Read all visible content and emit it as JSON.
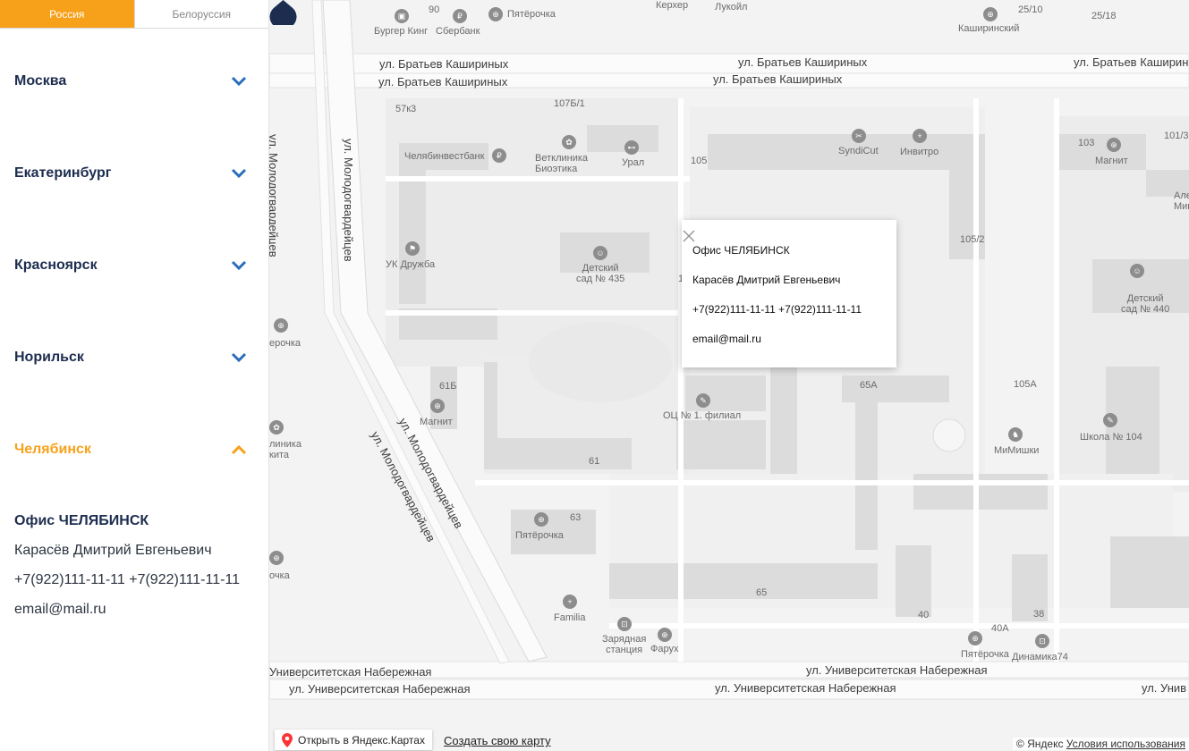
{
  "tabs": [
    {
      "label": "Россия",
      "active": true
    },
    {
      "label": "Белоруссия",
      "active": false
    }
  ],
  "cities": [
    {
      "name": "Москва",
      "open": false
    },
    {
      "name": "Екатеринбург",
      "open": false
    },
    {
      "name": "Красноярск",
      "open": false
    },
    {
      "name": "Норильск",
      "open": false
    },
    {
      "name": "Челябинск",
      "open": true
    }
  ],
  "office": {
    "title": "Офис ЧЕЛЯБИНСК",
    "person": "Карасёв Дмитрий Евгеньевич",
    "phones": "+7(922)111-11-11 +7(922)111-11-11",
    "email": "email@mail.ru"
  },
  "popup": {
    "title": "Офис ЧЕЛЯБИНСК",
    "person": "Карасёв Дмитрий Евгеньевич",
    "phones": "+7(922)111-11-11 +7(922)111-11-11",
    "email": "email@mail.ru"
  },
  "map": {
    "streets": {
      "bk1": "ул. Братьев Кашириных",
      "bk2": "ул. Братьев Кашириных",
      "bk3": "ул. Братьев Кашириных",
      "bk4": "ул. Братьев Кашириных",
      "bk5": "ул. Братьев Каширины",
      "mol1": "ул. Молодогвардейцев",
      "mol2": "ул. Молодогвардейцев",
      "mol3": "ул. Молодогвардейцев",
      "mol4": "ул. Молодогвардейцев",
      "un1": "Университетская Набережная",
      "un2": "ул. Университетская Набережная",
      "un3": "ул. Университетская Набережная",
      "un4": "ул. Университетская Набережная",
      "un5": "ул. Унив"
    },
    "places": {
      "burger": "Бургер Кинг",
      "sber": "Сбербанк",
      "pyat1": "Пятёрочка",
      "kerher": "Керхер",
      "lukoil": "Лукойл",
      "kash": "Каширинский",
      "chelinvest": "Челябинвестбанк",
      "vet": "Ветклиника\nБиоэтика",
      "ural": "Урал",
      "syndicut": "SyndiCut",
      "invitro": "Инвитро",
      "magnit1": "Магнит",
      "alea": "Але\nМикр",
      "uk": "УК Дружба",
      "ds435": "Детский\nсад № 435",
      "ds440": "Детский\nсад № 440",
      "pyat2": "ерочка",
      "magnit2": "Магнит",
      "ocn": "ОЦ № 1. филиал",
      "mimishki": "МиМишки",
      "shkola": "Школа № 104",
      "klinika": "линика\nкита",
      "pyat3": "Пятёрочка",
      "familia": "Familia",
      "zaryad": "Зарядная\nстанция",
      "faruh": "Фарух",
      "pyat4": "Пятёрочка",
      "dinamika": "Динамика74",
      "rochka": "очка"
    },
    "houses": {
      "h90": "90",
      "h25": "25/10",
      "h2518": "25/18",
      "h57": "57к3",
      "h107b": "107Б/1",
      "h105": "105",
      "h103": "103",
      "h1013": "101/3",
      "h1052": "105/2",
      "h61b": "61Б",
      "h65a": "65А",
      "h105a": "105А",
      "h61": "61",
      "h63": "63",
      "h65": "65",
      "h40": "40",
      "h40a": "40А",
      "h38": "38",
      "h1": "1"
    }
  },
  "footer": {
    "open_label": "Открыть в Яндекс.Картах",
    "create_label": "Создать свою карту",
    "copyright": "© Яндекс",
    "terms": "Условия использования"
  },
  "colors": {
    "accent": "#f7a11a",
    "city_text": "#1d2d4f",
    "chevron": "#2a6ebb",
    "pin": "#1d2d4f"
  }
}
